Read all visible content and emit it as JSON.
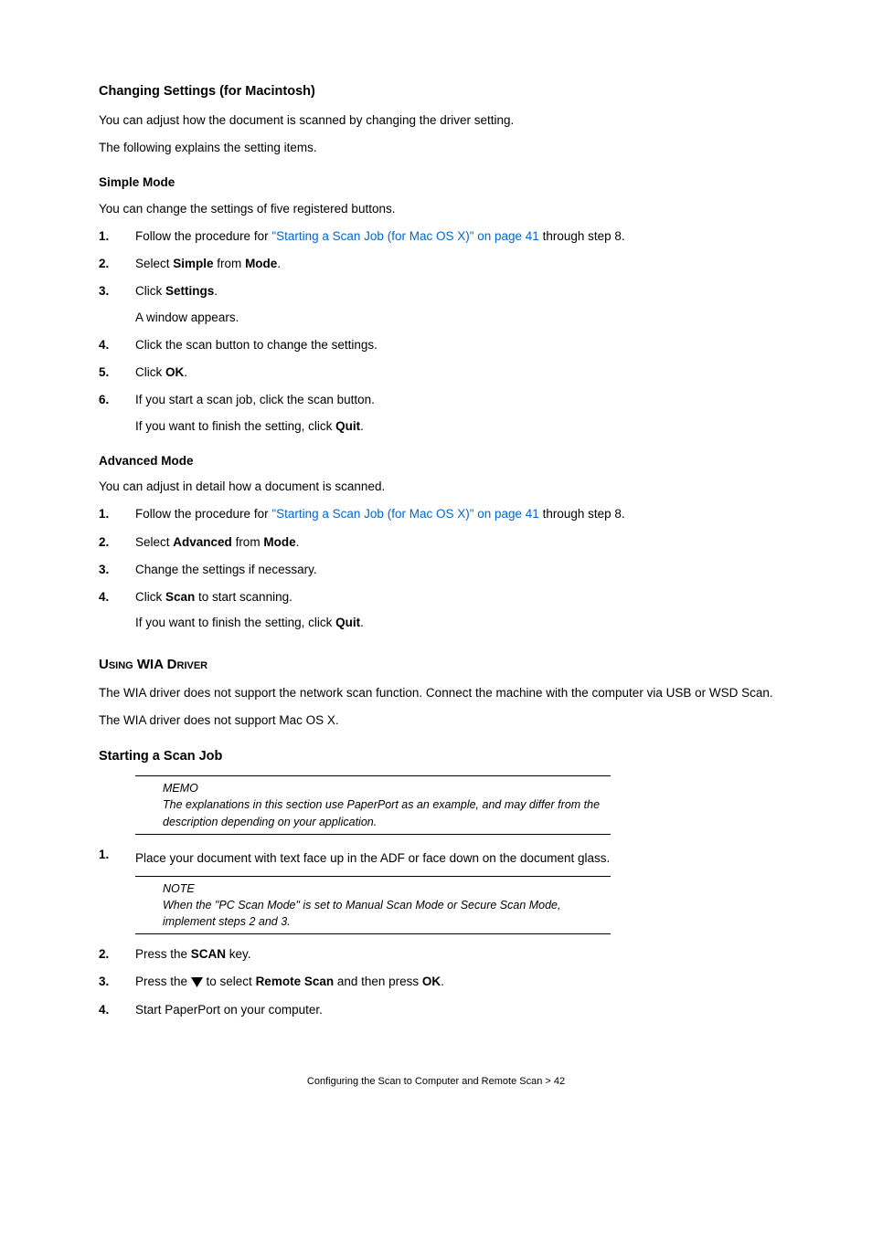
{
  "sec1": {
    "title": "Changing Settings (for Macintosh)",
    "p1": "You can adjust how the document is scanned by changing the driver setting.",
    "p2": "The following explains the setting items."
  },
  "simple": {
    "title": "Simple Mode",
    "intro": "You can change the settings of five registered buttons.",
    "steps": {
      "s1a": "Follow the procedure for ",
      "s1link": "\"Starting a Scan Job (for Mac OS X)\" on page 41",
      "s1b": " through step 8.",
      "s2a": "Select ",
      "s2b": "Simple",
      "s2c": " from ",
      "s2d": "Mode",
      "s2e": ".",
      "s3a": "Click ",
      "s3b": "Settings",
      "s3c": ".",
      "s3sub": "A window appears.",
      "s4": "Click the scan button to change the settings.",
      "s5a": "Click ",
      "s5b": "OK",
      "s5c": ".",
      "s6a": "If you start a scan job, click the scan button.",
      "s6suba": "If you want to finish the setting, click ",
      "s6subb": "Quit",
      "s6subc": "."
    }
  },
  "advanced": {
    "title": "Advanced Mode",
    "intro": "You can adjust in detail how a document is scanned.",
    "steps": {
      "s1a": "Follow the procedure for ",
      "s1link": "\"Starting a Scan Job (for Mac OS X)\" on page 41",
      "s1b": " through step 8.",
      "s2a": "Select ",
      "s2b": "Advanced",
      "s2c": " from ",
      "s2d": "Mode",
      "s2e": ".",
      "s3": "Change the settings if necessary.",
      "s4a": "Click ",
      "s4b": "Scan",
      "s4c": " to start scanning.",
      "s4suba": "If you want to finish the setting, click ",
      "s4subb": "Quit",
      "s4subc": "."
    }
  },
  "wia": {
    "title": "Using WIA Driver",
    "p1": "The WIA driver does not support the network scan function. Connect the machine with the computer via USB or WSD Scan.",
    "p2": "The WIA driver does not support Mac OS X."
  },
  "start": {
    "title": "Starting a Scan Job",
    "memo": {
      "label": "MEMO",
      "text": "The explanations in this section use PaperPort as an example, and may differ from the description depending on your application."
    },
    "steps": {
      "s1": "Place your document with text face up in the ADF or face down on the document glass.",
      "note": {
        "label": "NOTE",
        "text": "When the \"PC Scan Mode\" is set to Manual Scan Mode or Secure Scan Mode, implement steps 2 and 3."
      },
      "s2a": "Press the ",
      "s2b": "SCAN",
      "s2c": " key.",
      "s3a": "Press the ",
      "s3b": " to select ",
      "s3c": "Remote Scan",
      "s3d": " and then press ",
      "s3e": "OK",
      "s3f": ".",
      "s4": "Start PaperPort on your computer."
    }
  },
  "nums": {
    "n1": "1.",
    "n2": "2.",
    "n3": "3.",
    "n4": "4.",
    "n5": "5.",
    "n6": "6."
  },
  "footer": "Configuring the Scan to Computer and Remote Scan > 42"
}
